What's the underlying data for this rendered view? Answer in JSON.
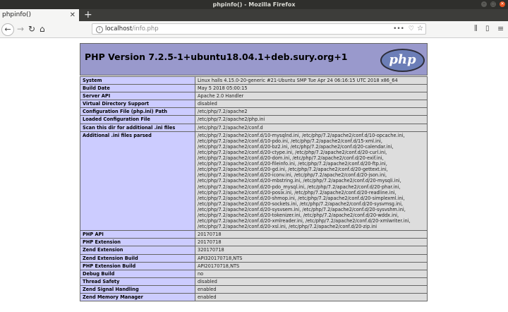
{
  "window": {
    "title": "phpinfo() - Mozilla Firefox",
    "minimize_glyph": "–",
    "maximize_glyph": "□",
    "close_glyph": "✕"
  },
  "tab": {
    "title": "phpinfo()",
    "close_glyph": "✕",
    "new_tab_glyph": "+"
  },
  "nav": {
    "back_glyph": "←",
    "forward_glyph": "→",
    "reload_glyph": "↻",
    "home_glyph": "⌂",
    "info_glyph": "i",
    "url_host": "localhost",
    "url_path": "/info.php",
    "more_glyph": "•••",
    "pocket_glyph": "♡",
    "star_glyph": "☆",
    "library_glyph": "⫼",
    "sidebar_glyph": "▯",
    "menu_glyph": "≡"
  },
  "php": {
    "title": "PHP Version 7.2.5-1+ubuntu18.04.1+deb.sury.org+1",
    "logo_text": "php"
  },
  "rows": [
    {
      "label": "System",
      "value": "Linux halls 4.15.0-20-generic #21-Ubuntu SMP Tue Apr 24 06:16:15 UTC 2018 x86_64"
    },
    {
      "label": "Build Date",
      "value": "May 5 2018 05:00:15"
    },
    {
      "label": "Server API",
      "value": "Apache 2.0 Handler"
    },
    {
      "label": "Virtual Directory Support",
      "value": "disabled"
    },
    {
      "label": "Configuration File (php.ini) Path",
      "value": "/etc/php/7.2/apache2"
    },
    {
      "label": "Loaded Configuration File",
      "value": "/etc/php/7.2/apache2/php.ini"
    },
    {
      "label": "Scan this dir for additional .ini files",
      "value": "/etc/php/7.2/apache2/conf.d"
    },
    {
      "label": "Additional .ini files parsed",
      "value": "/etc/php/7.2/apache2/conf.d/10-mysqlnd.ini, /etc/php/7.2/apache2/conf.d/10-opcache.ini, /etc/php/7.2/apache2/conf.d/10-pdo.ini, /etc/php/7.2/apache2/conf.d/15-xml.ini, /etc/php/7.2/apache2/conf.d/20-bz2.ini, /etc/php/7.2/apache2/conf.d/20-calendar.ini, /etc/php/7.2/apache2/conf.d/20-ctype.ini, /etc/php/7.2/apache2/conf.d/20-curl.ini, /etc/php/7.2/apache2/conf.d/20-dom.ini, /etc/php/7.2/apache2/conf.d/20-exif.ini, /etc/php/7.2/apache2/conf.d/20-fileinfo.ini, /etc/php/7.2/apache2/conf.d/20-ftp.ini, /etc/php/7.2/apache2/conf.d/20-gd.ini, /etc/php/7.2/apache2/conf.d/20-gettext.ini, /etc/php/7.2/apache2/conf.d/20-iconv.ini, /etc/php/7.2/apache2/conf.d/20-json.ini, /etc/php/7.2/apache2/conf.d/20-mbstring.ini, /etc/php/7.2/apache2/conf.d/20-mysqli.ini, /etc/php/7.2/apache2/conf.d/20-pdo_mysql.ini, /etc/php/7.2/apache2/conf.d/20-phar.ini, /etc/php/7.2/apache2/conf.d/20-posix.ini, /etc/php/7.2/apache2/conf.d/20-readline.ini, /etc/php/7.2/apache2/conf.d/20-shmop.ini, /etc/php/7.2/apache2/conf.d/20-simplexml.ini, /etc/php/7.2/apache2/conf.d/20-sockets.ini, /etc/php/7.2/apache2/conf.d/20-sysvmsg.ini, /etc/php/7.2/apache2/conf.d/20-sysvsem.ini, /etc/php/7.2/apache2/conf.d/20-sysvshm.ini, /etc/php/7.2/apache2/conf.d/20-tokenizer.ini, /etc/php/7.2/apache2/conf.d/20-wddx.ini, /etc/php/7.2/apache2/conf.d/20-xmlreader.ini, /etc/php/7.2/apache2/conf.d/20-xmlwriter.ini, /etc/php/7.2/apache2/conf.d/20-xsl.ini, /etc/php/7.2/apache2/conf.d/20-zip.ini"
    },
    {
      "label": "PHP API",
      "value": "20170718"
    },
    {
      "label": "PHP Extension",
      "value": "20170718"
    },
    {
      "label": "Zend Extension",
      "value": "320170718"
    },
    {
      "label": "Zend Extension Build",
      "value": "API320170718,NTS"
    },
    {
      "label": "PHP Extension Build",
      "value": "API20170718,NTS"
    },
    {
      "label": "Debug Build",
      "value": "no"
    },
    {
      "label": "Thread Safety",
      "value": "disabled"
    },
    {
      "label": "Zend Signal Handling",
      "value": "enabled"
    },
    {
      "label": "Zend Memory Manager",
      "value": "enabled"
    }
  ]
}
